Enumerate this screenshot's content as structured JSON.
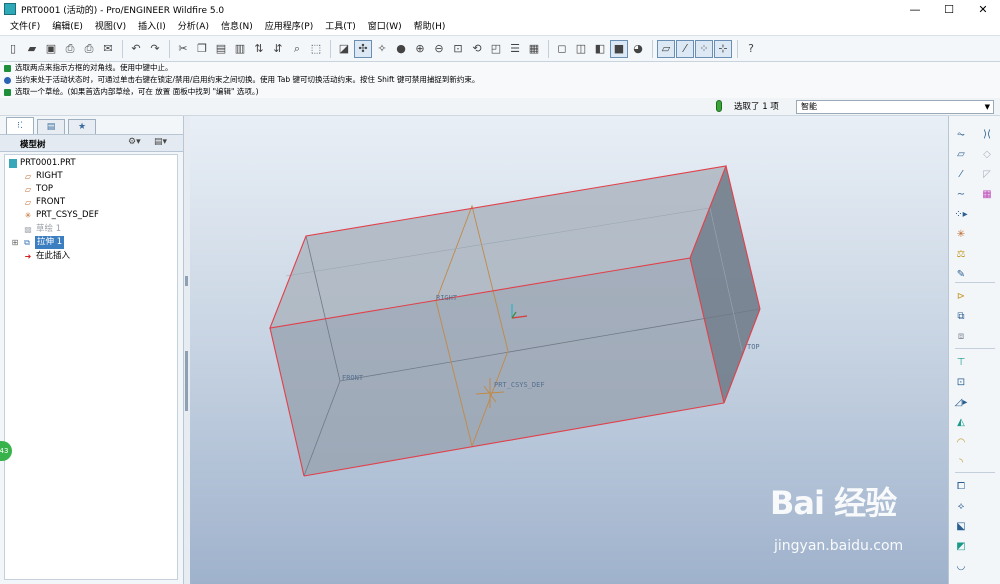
{
  "window": {
    "title": "PRT0001 (活动的) - Pro/ENGINEER Wildfire 5.0",
    "controls": {
      "minimize": "—",
      "maximize": "☐",
      "close": "✕"
    }
  },
  "menu": [
    "文件(F)",
    "编辑(E)",
    "视图(V)",
    "插入(I)",
    "分析(A)",
    "信息(N)",
    "应用程序(P)",
    "工具(T)",
    "窗口(W)",
    "帮助(H)"
  ],
  "toolbar_icons": [
    "new-file",
    "open-file",
    "save",
    "print",
    "print-preview",
    "send",
    "undo",
    "redo",
    "cut",
    "copy",
    "paste",
    "paste-special",
    "regenerate",
    "regenerate-manager",
    "find",
    "select-box",
    "repaint",
    "spin-center",
    "orient",
    "shading",
    "zoom-in",
    "zoom-out",
    "refit",
    "reorient",
    "saved-views",
    "layers",
    "view-manager",
    "wireframe",
    "hidden-line",
    "no-hidden",
    "shading-mode",
    "enhanced-realism",
    "datum-planes",
    "datum-axes",
    "datum-points",
    "coord-sys",
    "context-help"
  ],
  "messages": [
    {
      "color": "#1f8f3a",
      "text": "选取两点来指示方框的对角线。使用中键中止。"
    },
    {
      "color": "#2a62b5",
      "text": "当约束处于活动状态时，可通过单击右键在锁定/禁用/启用约束之间切换。使用 Tab 键可切换活动约束。按住 Shift 键可禁用捕捉到新约束。"
    },
    {
      "color": "#1f8f3a",
      "text": "选取一个草绘。(如果首选内部草绘，可在 放置 面板中找到 \"编辑\" 选项。)"
    }
  ],
  "selection": {
    "text": "选取了 1 项",
    "filter": "智能"
  },
  "model_tree": {
    "header": "模型树",
    "items": [
      {
        "label": "PRT0001.PRT",
        "icon": "part-icon",
        "state": "normal"
      },
      {
        "label": "RIGHT",
        "icon": "datum-plane-icon",
        "state": "normal"
      },
      {
        "label": "TOP",
        "icon": "datum-plane-icon",
        "state": "normal"
      },
      {
        "label": "FRONT",
        "icon": "datum-plane-icon",
        "state": "normal"
      },
      {
        "label": "PRT_CSYS_DEF",
        "icon": "csys-icon",
        "state": "normal"
      },
      {
        "label": "草绘 1",
        "icon": "sketch-icon",
        "state": "suppressed"
      },
      {
        "label": "拉伸 1",
        "icon": "extrude-icon",
        "state": "selected"
      },
      {
        "label": "在此插入",
        "icon": "insert-arrow-icon",
        "state": "normal"
      }
    ]
  },
  "viewport": {
    "datum_labels": {
      "right": "RIGHT",
      "top": "TOP",
      "front": "FRONT",
      "csys": "PRT_CSYS_DEF"
    },
    "colors": {
      "edge": "#e0404a",
      "datum": "#c08a48",
      "face": "#a4adb8"
    }
  },
  "side_badge": "43",
  "watermark": {
    "main": "Bai 经验",
    "sub": "jingyan.baidu.com"
  }
}
